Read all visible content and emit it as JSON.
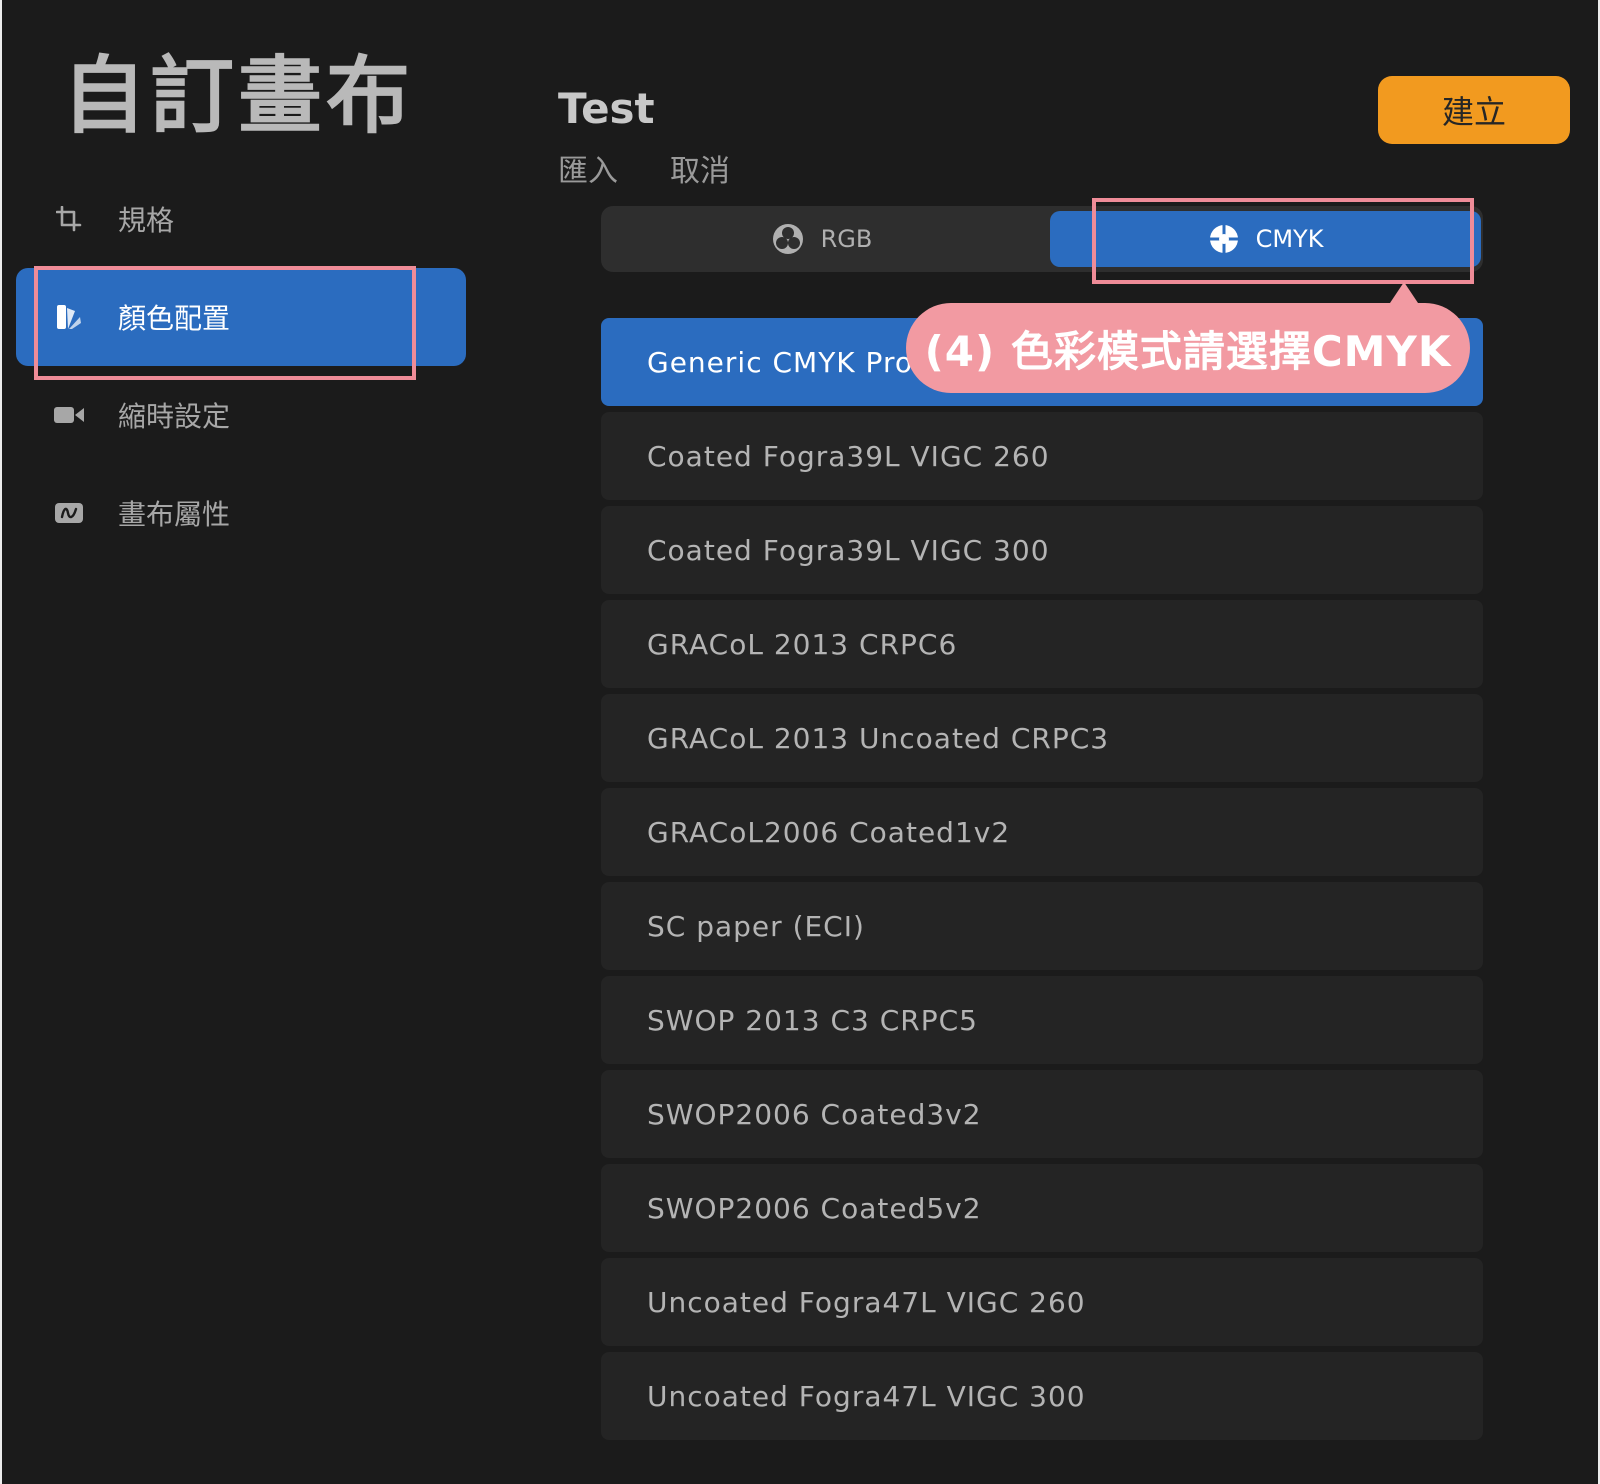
{
  "page_title": "自訂畫布",
  "sidebar": {
    "items": [
      {
        "label": "規格",
        "icon": "crop-icon"
      },
      {
        "label": "顏色配置",
        "icon": "color-profile-icon",
        "active": true
      },
      {
        "label": "縮時設定",
        "icon": "video-camera-icon"
      },
      {
        "label": "畫布屬性",
        "icon": "canvas-properties-icon"
      }
    ]
  },
  "header": {
    "canvas_name": "Test",
    "import_label": "匯入",
    "cancel_label": "取消",
    "create_label": "建立"
  },
  "color_mode": {
    "options": [
      {
        "label": "RGB",
        "icon": "rgb-icon"
      },
      {
        "label": "CMYK",
        "icon": "cmyk-icon",
        "selected": true
      }
    ]
  },
  "profiles": [
    {
      "name": "Generic CMYK Profile",
      "selected": true
    },
    {
      "name": "Coated Fogra39L VIGC 260"
    },
    {
      "name": "Coated Fogra39L VIGC 300"
    },
    {
      "name": "GRACoL 2013 CRPC6"
    },
    {
      "name": "GRACoL 2013 Uncoated CRPC3"
    },
    {
      "name": "GRACoL2006 Coated1v2"
    },
    {
      "name": "SC paper (ECI)"
    },
    {
      "name": "SWOP 2013 C3 CRPC5"
    },
    {
      "name": "SWOP2006 Coated3v2"
    },
    {
      "name": "SWOP2006 Coated5v2"
    },
    {
      "name": "Uncoated Fogra47L VIGC 260"
    },
    {
      "name": "Uncoated Fogra47L VIGC 300"
    }
  ],
  "annotation": {
    "text": "(4) 色彩模式請選擇CMYK",
    "color": "#f29aa2"
  },
  "colors": {
    "accent": "#2b6cbf",
    "create_button": "#f29a1f",
    "background": "#1b1b1b",
    "highlight_border": "#ef8c98"
  }
}
